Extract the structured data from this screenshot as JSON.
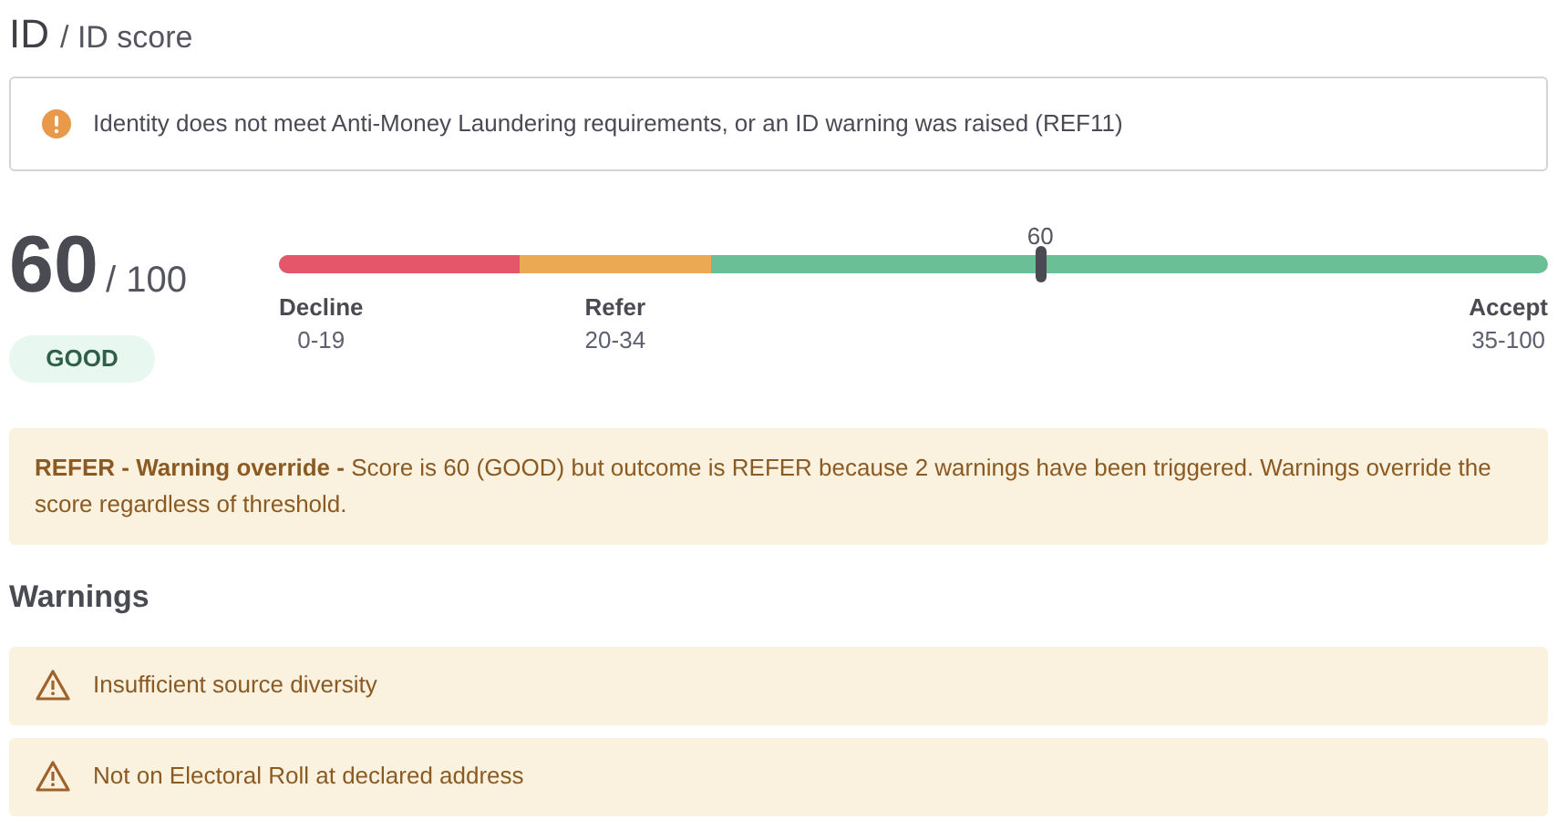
{
  "breadcrumb": {
    "title": "ID",
    "subtitle": "/ ID score"
  },
  "alert": {
    "text": "Identity does not meet Anti-Money Laundering requirements, or an ID warning was raised (REF11)"
  },
  "score": {
    "value": "60",
    "max": "/ 100",
    "rating": "GOOD"
  },
  "scale": {
    "marker": {
      "label": "60",
      "level": 0.6
    },
    "bands": [
      {
        "label": "Decline",
        "range": "0-19",
        "color": "#e5566b"
      },
      {
        "label": "Refer",
        "range": "20-34",
        "color": "#eaa952"
      },
      {
        "label": "Accept",
        "range": "35-100",
        "color": "#6bbf96"
      }
    ]
  },
  "override": {
    "text": "**REFER - Warning override -** Score is 60 (GOOD) but outcome is REFER because 2 warnings have been triggered. Warnings override the score regardless of threshold."
  },
  "warnings": {
    "heading": "Warnings",
    "items": [
      {
        "text": "Insufficient source diversity"
      },
      {
        "text": "Not on Electoral Roll at declared address"
      }
    ]
  }
}
